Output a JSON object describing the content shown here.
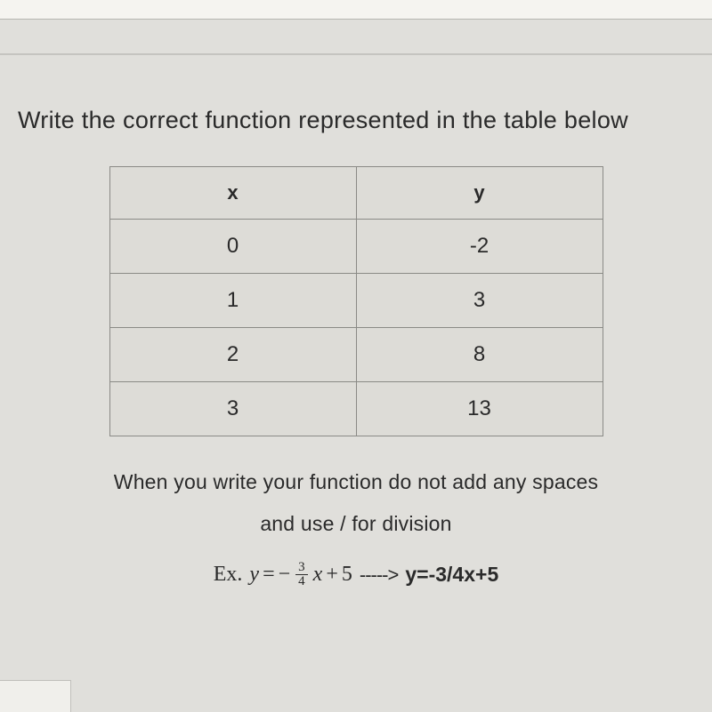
{
  "question": {
    "title": "Write the correct function represented in the table below",
    "instruction_line_1": "When you write your function do not add any spaces",
    "instruction_line_2": "and use / for division",
    "example": {
      "label": "Ex.",
      "math_y": "y",
      "math_eq": "=",
      "math_neg": "−",
      "math_frac_num": "3",
      "math_frac_den": "4",
      "math_x": "x",
      "math_plus": "+",
      "math_const": "5",
      "arrow": "----->",
      "plain": "y=-3/4x+5"
    }
  },
  "table": {
    "headers": {
      "col1": "x",
      "col2": "y"
    },
    "rows": [
      {
        "x": "0",
        "y": "-2"
      },
      {
        "x": "1",
        "y": "3"
      },
      {
        "x": "2",
        "y": "8"
      },
      {
        "x": "3",
        "y": "13"
      }
    ]
  }
}
